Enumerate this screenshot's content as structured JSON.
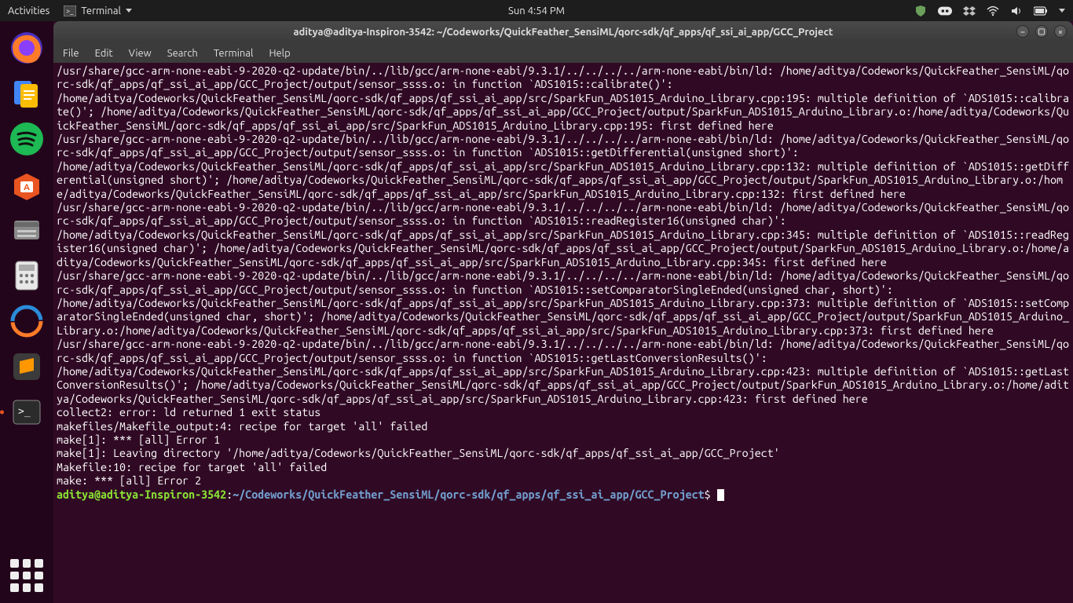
{
  "panel": {
    "activities": "Activities",
    "app_label": "Terminal",
    "clock": "Sun  4:54 PM"
  },
  "window": {
    "title": "aditya@aditya-Inspiron-3542: ~/Codeworks/QuickFeather_SensiML/qorc-sdk/qf_apps/qf_ssi_ai_app/GCC_Project"
  },
  "menubar": {
    "file": "File",
    "edit": "Edit",
    "view": "View",
    "search": "Search",
    "terminal": "Terminal",
    "help": "Help"
  },
  "terminal": {
    "lines": "/usr/share/gcc-arm-none-eabi-9-2020-q2-update/bin/../lib/gcc/arm-none-eabi/9.3.1/../../../../arm-none-eabi/bin/ld: /home/aditya/Codeworks/QuickFeather_SensiML/qorc-sdk/qf_apps/qf_ssi_ai_app/GCC_Project/output/sensor_ssss.o: in function `ADS1015::calibrate()':\n/home/aditya/Codeworks/QuickFeather_SensiML/qorc-sdk/qf_apps/qf_ssi_ai_app/src/SparkFun_ADS1015_Arduino_Library.cpp:195: multiple definition of `ADS1015::calibrate()'; /home/aditya/Codeworks/QuickFeather_SensiML/qorc-sdk/qf_apps/qf_ssi_ai_app/GCC_Project/output/SparkFun_ADS1015_Arduino_Library.o:/home/aditya/Codeworks/QuickFeather_SensiML/qorc-sdk/qf_apps/qf_ssi_ai_app/src/SparkFun_ADS1015_Arduino_Library.cpp:195: first defined here\n/usr/share/gcc-arm-none-eabi-9-2020-q2-update/bin/../lib/gcc/arm-none-eabi/9.3.1/../../../../arm-none-eabi/bin/ld: /home/aditya/Codeworks/QuickFeather_SensiML/qorc-sdk/qf_apps/qf_ssi_ai_app/GCC_Project/output/sensor_ssss.o: in function `ADS1015::getDifferential(unsigned short)':\n/home/aditya/Codeworks/QuickFeather_SensiML/qorc-sdk/qf_apps/qf_ssi_ai_app/src/SparkFun_ADS1015_Arduino_Library.cpp:132: multiple definition of `ADS1015::getDifferential(unsigned short)'; /home/aditya/Codeworks/QuickFeather_SensiML/qorc-sdk/qf_apps/qf_ssi_ai_app/GCC_Project/output/SparkFun_ADS1015_Arduino_Library.o:/home/aditya/Codeworks/QuickFeather_SensiML/qorc-sdk/qf_apps/qf_ssi_ai_app/src/SparkFun_ADS1015_Arduino_Library.cpp:132: first defined here\n/usr/share/gcc-arm-none-eabi-9-2020-q2-update/bin/../lib/gcc/arm-none-eabi/9.3.1/../../../../arm-none-eabi/bin/ld: /home/aditya/Codeworks/QuickFeather_SensiML/qorc-sdk/qf_apps/qf_ssi_ai_app/GCC_Project/output/sensor_ssss.o: in function `ADS1015::readRegister16(unsigned char)':\n/home/aditya/Codeworks/QuickFeather_SensiML/qorc-sdk/qf_apps/qf_ssi_ai_app/src/SparkFun_ADS1015_Arduino_Library.cpp:345: multiple definition of `ADS1015::readRegister16(unsigned char)'; /home/aditya/Codeworks/QuickFeather_SensiML/qorc-sdk/qf_apps/qf_ssi_ai_app/GCC_Project/output/SparkFun_ADS1015_Arduino_Library.o:/home/aditya/Codeworks/QuickFeather_SensiML/qorc-sdk/qf_apps/qf_ssi_ai_app/src/SparkFun_ADS1015_Arduino_Library.cpp:345: first defined here\n/usr/share/gcc-arm-none-eabi-9-2020-q2-update/bin/../lib/gcc/arm-none-eabi/9.3.1/../../../../arm-none-eabi/bin/ld: /home/aditya/Codeworks/QuickFeather_SensiML/qorc-sdk/qf_apps/qf_ssi_ai_app/GCC_Project/output/sensor_ssss.o: in function `ADS1015::setComparatorSingleEnded(unsigned char, short)':\n/home/aditya/Codeworks/QuickFeather_SensiML/qorc-sdk/qf_apps/qf_ssi_ai_app/src/SparkFun_ADS1015_Arduino_Library.cpp:373: multiple definition of `ADS1015::setComparatorSingleEnded(unsigned char, short)'; /home/aditya/Codeworks/QuickFeather_SensiML/qorc-sdk/qf_apps/qf_ssi_ai_app/GCC_Project/output/SparkFun_ADS1015_Arduino_Library.o:/home/aditya/Codeworks/QuickFeather_SensiML/qorc-sdk/qf_apps/qf_ssi_ai_app/src/SparkFun_ADS1015_Arduino_Library.cpp:373: first defined here\n/usr/share/gcc-arm-none-eabi-9-2020-q2-update/bin/../lib/gcc/arm-none-eabi/9.3.1/../../../../arm-none-eabi/bin/ld: /home/aditya/Codeworks/QuickFeather_SensiML/qorc-sdk/qf_apps/qf_ssi_ai_app/GCC_Project/output/sensor_ssss.o: in function `ADS1015::getLastConversionResults()':\n/home/aditya/Codeworks/QuickFeather_SensiML/qorc-sdk/qf_apps/qf_ssi_ai_app/src/SparkFun_ADS1015_Arduino_Library.cpp:423: multiple definition of `ADS1015::getLastConversionResults()'; /home/aditya/Codeworks/QuickFeather_SensiML/qorc-sdk/qf_apps/qf_ssi_ai_app/GCC_Project/output/SparkFun_ADS1015_Arduino_Library.o:/home/aditya/Codeworks/QuickFeather_SensiML/qorc-sdk/qf_apps/qf_ssi_ai_app/src/SparkFun_ADS1015_Arduino_Library.cpp:423: first defined here\ncollect2: error: ld returned 1 exit status\nmakefiles/Makefile_output:4: recipe for target 'all' failed\nmake[1]: *** [all] Error 1\nmake[1]: Leaving directory '/home/aditya/Codeworks/QuickFeather_SensiML/qorc-sdk/qf_apps/qf_ssi_ai_app/GCC_Project'\nMakefile:10: recipe for target 'all' failed\nmake: *** [all] Error 2",
    "prompt_user": "aditya@aditya-Inspiron-3542",
    "prompt_colon": ":",
    "prompt_path": "~/Codeworks/QuickFeather_SensiML/qorc-sdk/qf_apps/qf_ssi_ai_app/GCC_Project",
    "prompt_end": "$ "
  }
}
